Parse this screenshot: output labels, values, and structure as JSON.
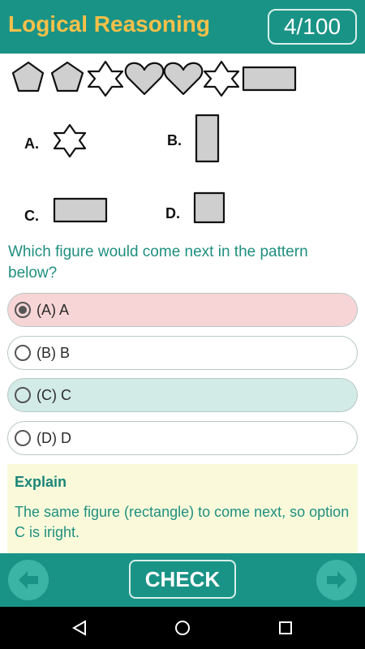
{
  "header": {
    "title": "Logical Reasoning",
    "counter": "4/100"
  },
  "figure": {
    "sequence_icons": [
      "pentagon",
      "pentagon",
      "star",
      "heart",
      "heart",
      "star",
      "rectangle"
    ],
    "choices": [
      {
        "letter": "A.",
        "shape": "star"
      },
      {
        "letter": "B.",
        "shape": "tall-rectangle"
      },
      {
        "letter": "C.",
        "shape": "wide-rectangle"
      },
      {
        "letter": "D.",
        "shape": "square"
      }
    ]
  },
  "question": {
    "text": "Which figure would come next in the pattern below?"
  },
  "options": [
    {
      "label": "(A) A",
      "state": "selected"
    },
    {
      "label": "(B) B",
      "state": "normal"
    },
    {
      "label": "(C) C",
      "state": "correct"
    },
    {
      "label": "(D) D",
      "state": "normal"
    }
  ],
  "explain": {
    "title": "Explain",
    "text": "The same figure (rectangle) to come next, so option C is iright."
  },
  "bottom": {
    "check_label": "CHECK",
    "prev_icon": "arrow-left-icon",
    "next_icon": "arrow-right-icon"
  },
  "colors": {
    "primary": "#1a9387",
    "title": "#f7c04a",
    "selected_bg": "#f7d5d6",
    "correct_bg": "#d3ebe7",
    "explain_bg": "#fafadb"
  }
}
